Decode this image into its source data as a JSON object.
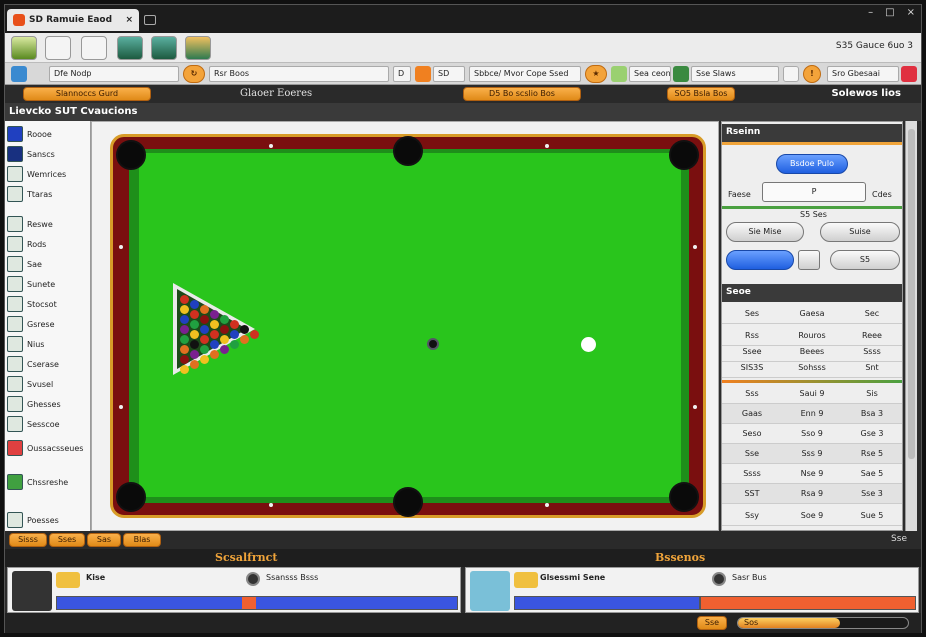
{
  "browser": {
    "tab_title": "SD Ramuie Eaod",
    "tab_close": "×",
    "window_controls": [
      "–",
      "□",
      "×"
    ],
    "toolbar_right": "S35 Gauce 6uo 3"
  },
  "address": {
    "field1": "Dfe Nodp",
    "field2": "Rsr Boos",
    "field3": "D",
    "field4": "SD",
    "field5": "Sbbce/ Mvor Cope Ssed",
    "field6": "Sea ceon",
    "field7": "Sse Slaws",
    "field8": "Sro Gbesaai"
  },
  "actionbar": {
    "left_btn": "Slannoccs Gurd",
    "center_title": "Glaoer Eoeres",
    "center_btn": "D5 Bo scslio Bos",
    "right_btn": "SO5 Bsla Bos",
    "right_title": "Solewos lios"
  },
  "heading": "Lievcko SUT Cvaucions",
  "sidebar": {
    "items": [
      "Roooe",
      "Sanscs",
      "Wemrices",
      "Ttaras",
      "Reswe",
      "Rods",
      "Sae",
      "Sunete",
      "Stocsot",
      "Gsrese",
      "Nius",
      "Cserase",
      "Svusel",
      "Ghesses",
      "Sesscoe",
      "Oussacsseues",
      "Chssreshe",
      "Poesses"
    ]
  },
  "right_panel": {
    "header1": "Rseinn",
    "blue_pill": "Bsdoe Pulo",
    "label_left": "Faese",
    "stepper_value": "P",
    "label_right": "Cdes",
    "sub_label": "S5 Ses",
    "pill_left": "Sie Mise",
    "pill_right": "Suise",
    "pill_blue2": "",
    "pill_small": "S5",
    "header2": "Seoe",
    "rows": [
      [
        "Ses",
        "Gaesa",
        "Sec"
      ],
      [
        "Rss",
        "Rouros",
        "Reee"
      ],
      [
        "Ssee",
        "Beees",
        "Ssss"
      ],
      [
        "SIS3S",
        "Sohsss",
        "Snt"
      ],
      [
        "Sss",
        "Saui 9",
        "Sis"
      ],
      [
        "Gaas",
        "Enn 9",
        "Bsa 3"
      ],
      [
        "Seso",
        "Sso 9",
        "Gse 3"
      ],
      [
        "Sse",
        "Sss 9",
        "Rse 5"
      ],
      [
        "Ssss",
        "Nse 9",
        "Sae 5"
      ],
      [
        "SST",
        "Rsa 9",
        "Sse 3"
      ],
      [
        "Ssy",
        "Soe 9",
        "Sue 5"
      ]
    ]
  },
  "bottom_bar": {
    "buttons": [
      "Sisss",
      "Sses",
      "Sas",
      "Blas"
    ],
    "right": "Sse"
  },
  "stats": {
    "left_title": "Scsalfrnct",
    "right_title": "Bssenos",
    "player1_name": "Kise",
    "player1_stat": "Ssansss Bsss",
    "player2_name": "Glsessmi Sene",
    "player2_stat": "Sasr Bus"
  },
  "footer": {
    "label": "Sse",
    "progress_label": "Sos",
    "progress": 0.6
  },
  "colors": {
    "felt": "#29c51c",
    "rail": "#7a0f0f",
    "accent": "#f3a33a",
    "blue": "#2f5fe0"
  }
}
